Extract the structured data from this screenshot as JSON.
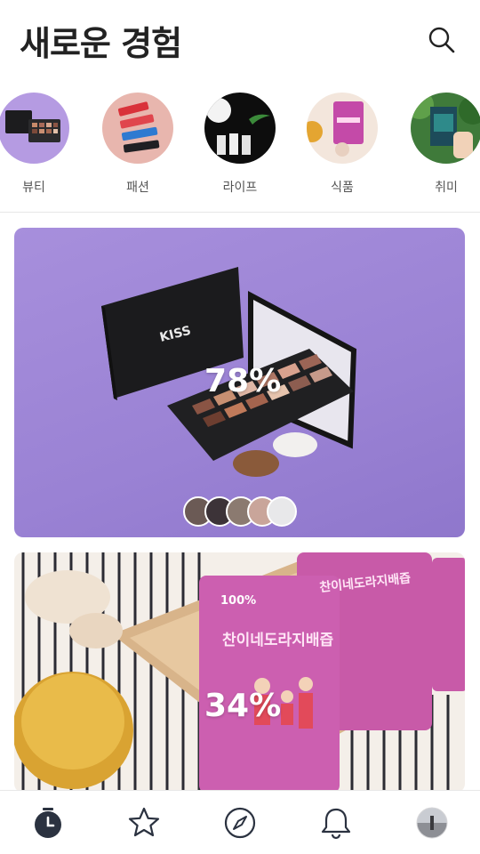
{
  "header": {
    "title": "새로운 경험"
  },
  "categories": [
    {
      "label": "뷰티",
      "icon": "beauty-palette-thumb"
    },
    {
      "label": "패션",
      "icon": "fashion-keychain-thumb"
    },
    {
      "label": "라이프",
      "icon": "life-tubes-thumb"
    },
    {
      "label": "식품",
      "icon": "food-pouch-thumb"
    },
    {
      "label": "취미",
      "icon": "hobby-book-thumb"
    }
  ],
  "feed": [
    {
      "percent": "78%",
      "brand_text": "KISS",
      "participants": 5
    },
    {
      "percent": "34%",
      "product_text": "찬이네도라지배즙",
      "badge_text": "100%"
    }
  ],
  "bottom_nav": [
    {
      "icon": "clock-icon",
      "active": true
    },
    {
      "icon": "star-icon"
    },
    {
      "icon": "compass-icon"
    },
    {
      "icon": "bell-icon"
    },
    {
      "icon": "profile-avatar"
    }
  ],
  "colors": {
    "accent_dark": "#2b3240",
    "card1_bg": "#a08ad8",
    "divider": "#e6e6e6"
  }
}
